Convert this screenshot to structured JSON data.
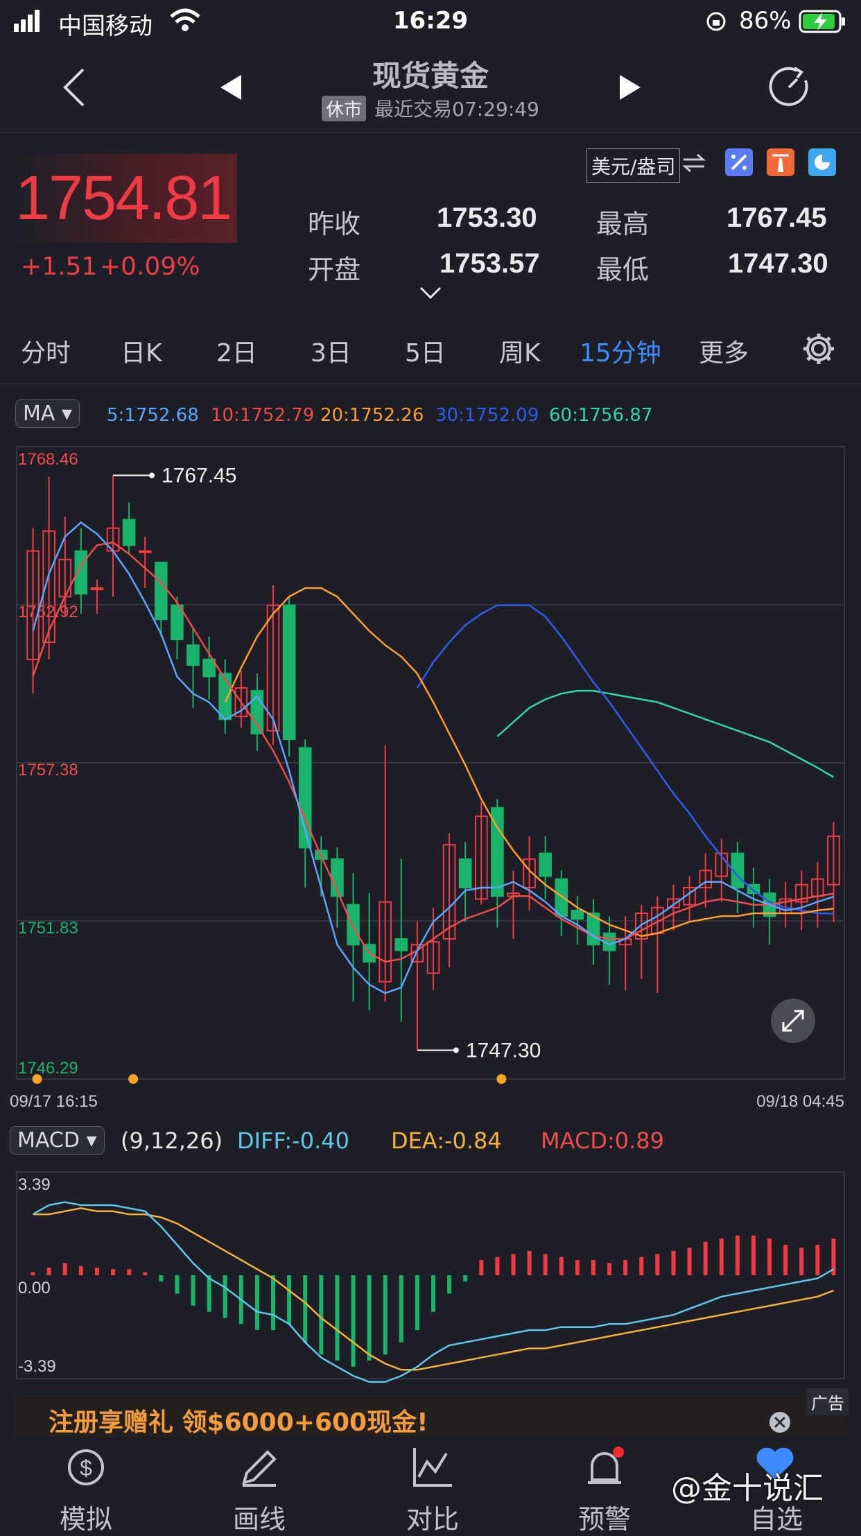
{
  "status": {
    "carrier": "中国移动",
    "time": "16:29",
    "battery": "86%"
  },
  "nav": {
    "title": "现货黄金",
    "market_status": "休市",
    "last_trade": "最近交易07:29:49"
  },
  "quote": {
    "price": "1754.81",
    "change": "+1.51",
    "change_pct": "+0.09%",
    "currency": "美元/盎司",
    "prev_close_label": "昨收",
    "prev_close": "1753.30",
    "high_label": "最高",
    "high": "1767.45",
    "open_label": "开盘",
    "open": "1753.57",
    "low_label": "最低",
    "low": "1747.30"
  },
  "tabs": [
    "分时",
    "日K",
    "2日",
    "3日",
    "5日",
    "周K",
    "15分钟",
    "更多"
  ],
  "active_tab": "15分钟",
  "ma": {
    "badge": "MA",
    "ma5": "5:1752.68",
    "ma10": "10:1752.79",
    "ma20": "20:1752.26",
    "ma30": "30:1752.09",
    "ma60": "60:1756.87"
  },
  "colors": {
    "up": "#ef3b45",
    "down": "#19b36b",
    "ma5": "#5aa6ff",
    "ma10": "#ef4b4b",
    "ma20": "#ff9d2e",
    "ma30": "#2f5cf0",
    "ma60": "#33d6a5",
    "accent": "#3d8bff"
  },
  "price_chart": {
    "y_labels": [
      "1768.46",
      "1762.92",
      "1757.38",
      "1751.83",
      "1746.29"
    ],
    "high_marker": "1767.45",
    "low_marker": "1747.30",
    "x_start": "09/17 16:15",
    "x_end": "09/18 04:45"
  },
  "macd": {
    "badge": "MACD",
    "params": "(9,12,26)",
    "diff": "DIFF:-0.40",
    "dea": "DEA:-0.84",
    "macd": "MACD:0.89",
    "y_labels": [
      "3.39",
      "0.00",
      "-3.39"
    ]
  },
  "ad": {
    "text": "注册享赠礼 领$6000+600现金!",
    "tag": "广告"
  },
  "bottom_nav": [
    "模拟",
    "画线",
    "对比",
    "预警",
    "自选"
  ],
  "watermark": "@金十说汇",
  "chart_data": {
    "type": "candlestick",
    "ylim": [
      1746.29,
      1768.46
    ],
    "candles": [
      [
        1761.0,
        1764.8,
        1759.8,
        1765.6
      ],
      [
        1761.6,
        1765.5,
        1761.0,
        1767.4
      ],
      [
        1763.2,
        1764.5,
        1762.5,
        1766.0
      ],
      [
        1764.8,
        1763.3,
        1762.6,
        1765.6
      ],
      [
        1763.5,
        1763.5,
        1762.6,
        1763.8
      ],
      [
        1764.8,
        1765.6,
        1763.2,
        1767.45
      ],
      [
        1765.9,
        1765.0,
        1764.7,
        1766.5
      ],
      [
        1764.8,
        1764.8,
        1763.5,
        1765.3
      ],
      [
        1764.4,
        1762.4,
        1761.8,
        1764.4
      ],
      [
        1762.9,
        1761.7,
        1761.0,
        1763.2
      ],
      [
        1761.5,
        1760.8,
        1759.3,
        1762.1
      ],
      [
        1761.0,
        1760.4,
        1759.6,
        1761.8
      ],
      [
        1760.5,
        1758.9,
        1758.4,
        1761.0
      ],
      [
        1759.0,
        1760.0,
        1758.6,
        1760.6
      ],
      [
        1759.9,
        1758.4,
        1757.8,
        1760.5
      ],
      [
        1758.5,
        1762.9,
        1758.0,
        1763.6
      ],
      [
        1762.9,
        1758.2,
        1757.6,
        1763.2
      ],
      [
        1757.9,
        1754.4,
        1753.0,
        1758.2
      ],
      [
        1754.3,
        1754.0,
        1752.7,
        1754.8
      ],
      [
        1754.0,
        1752.7,
        1751.6,
        1754.4
      ],
      [
        1752.4,
        1751.0,
        1749.0,
        1753.5
      ],
      [
        1751.0,
        1750.4,
        1748.7,
        1752.8
      ],
      [
        1749.7,
        1752.5,
        1749.0,
        1758.0
      ],
      [
        1751.2,
        1750.8,
        1748.3,
        1754.0
      ],
      [
        1750.4,
        1751.0,
        1747.3,
        1751.8
      ],
      [
        1750.0,
        1751.1,
        1749.4,
        1752.3
      ],
      [
        1751.2,
        1754.5,
        1750.2,
        1754.9
      ],
      [
        1754.0,
        1753.0,
        1751.8,
        1754.6
      ],
      [
        1752.6,
        1755.5,
        1752.4,
        1756.0
      ],
      [
        1755.8,
        1752.7,
        1751.6,
        1756.1
      ],
      [
        1752.7,
        1752.8,
        1751.2,
        1753.6
      ],
      [
        1753.0,
        1754.0,
        1752.2,
        1754.8
      ],
      [
        1754.2,
        1753.4,
        1752.6,
        1754.8
      ],
      [
        1753.3,
        1752.0,
        1751.3,
        1753.6
      ],
      [
        1752.2,
        1751.9,
        1751.0,
        1752.7
      ],
      [
        1752.1,
        1751.0,
        1750.3,
        1752.6
      ],
      [
        1751.4,
        1750.8,
        1749.6,
        1752.0
      ],
      [
        1751.0,
        1751.2,
        1749.4,
        1752.0
      ],
      [
        1751.2,
        1752.1,
        1749.8,
        1752.4
      ],
      [
        1751.4,
        1752.3,
        1749.3,
        1752.7
      ],
      [
        1752.3,
        1752.6,
        1751.5,
        1753.1
      ],
      [
        1752.4,
        1753.0,
        1751.8,
        1753.4
      ],
      [
        1753.0,
        1753.6,
        1752.3,
        1754.2
      ],
      [
        1753.4,
        1754.2,
        1752.5,
        1754.7
      ],
      [
        1754.2,
        1753.0,
        1752.1,
        1754.6
      ],
      [
        1753.1,
        1752.8,
        1751.6,
        1753.7
      ],
      [
        1752.8,
        1752.0,
        1751.0,
        1753.3
      ],
      [
        1752.1,
        1752.6,
        1751.6,
        1753.2
      ],
      [
        1752.5,
        1753.1,
        1751.5,
        1753.6
      ],
      [
        1752.7,
        1753.3,
        1751.6,
        1753.9
      ],
      [
        1753.1,
        1754.8,
        1751.8,
        1755.3
      ]
    ],
    "macd_hist": [
      0.1,
      0.25,
      0.4,
      0.3,
      0.25,
      0.2,
      0.2,
      0.1,
      -0.2,
      -0.6,
      -1.0,
      -1.2,
      -1.4,
      -1.6,
      -1.8,
      -1.8,
      -1.6,
      -2.2,
      -2.6,
      -2.8,
      -3.0,
      -2.8,
      -2.6,
      -2.2,
      -1.8,
      -1.2,
      -0.6,
      -0.2,
      0.5,
      0.6,
      0.7,
      0.8,
      0.7,
      0.6,
      0.5,
      0.5,
      0.4,
      0.5,
      0.6,
      0.7,
      0.8,
      0.9,
      1.1,
      1.2,
      1.3,
      1.3,
      1.2,
      1.0,
      0.9,
      1.0,
      1.2
    ],
    "diff": [
      2.0,
      2.3,
      2.4,
      2.3,
      2.3,
      2.3,
      2.2,
      2.1,
      1.6,
      1.0,
      0.4,
      -0.1,
      -0.4,
      -0.8,
      -1.2,
      -1.3,
      -1.6,
      -2.2,
      -2.7,
      -3.0,
      -3.3,
      -3.5,
      -3.5,
      -3.3,
      -3.0,
      -2.6,
      -2.3,
      -2.2,
      -2.1,
      -2.0,
      -1.9,
      -1.8,
      -1.8,
      -1.7,
      -1.7,
      -1.7,
      -1.6,
      -1.6,
      -1.5,
      -1.4,
      -1.3,
      -1.1,
      -0.9,
      -0.7,
      -0.6,
      -0.5,
      -0.4,
      -0.3,
      -0.2,
      -0.1,
      0.2
    ],
    "dea": [
      2.0,
      2.0,
      2.1,
      2.2,
      2.1,
      2.1,
      2.0,
      2.0,
      1.9,
      1.7,
      1.4,
      1.1,
      0.8,
      0.5,
      0.2,
      -0.1,
      -0.5,
      -0.9,
      -1.4,
      -1.8,
      -2.2,
      -2.6,
      -2.9,
      -3.1,
      -3.1,
      -3.0,
      -2.9,
      -2.8,
      -2.7,
      -2.6,
      -2.5,
      -2.4,
      -2.4,
      -2.3,
      -2.2,
      -2.1,
      -2.0,
      -1.9,
      -1.8,
      -1.7,
      -1.6,
      -1.5,
      -1.4,
      -1.3,
      -1.2,
      -1.1,
      -1.0,
      -0.9,
      -0.8,
      -0.7,
      -0.5
    ],
    "ma5": [
      1762.0,
      1764.0,
      1765.3,
      1765.8,
      1765.4,
      1764.8,
      1764.0,
      1763.0,
      1761.9,
      1760.4,
      1759.8,
      1759.5,
      1758.9,
      1759.2,
      1759.7,
      1758.9,
      1757.1,
      1755.0,
      1753.0,
      1751.0,
      1750.2,
      1749.6,
      1749.3,
      1749.5,
      1750.8,
      1751.8,
      1752.3,
      1752.9,
      1753.0,
      1753.0,
      1753.2,
      1752.9,
      1752.5,
      1752.0,
      1751.7,
      1751.3,
      1751.0,
      1751.2,
      1751.7,
      1752.0,
      1752.4,
      1752.8,
      1753.2,
      1753.2,
      1752.9,
      1752.6,
      1752.4,
      1752.2,
      1752.3,
      1752.5,
      1752.68
    ],
    "ma10": [
      1760.4,
      1762.0,
      1763.2,
      1764.3,
      1765.0,
      1765.1,
      1764.7,
      1764.2,
      1763.7,
      1763.0,
      1762.1,
      1761.2,
      1760.3,
      1759.5,
      1758.7,
      1757.8,
      1756.7,
      1755.4,
      1754.1,
      1752.9,
      1751.6,
      1750.7,
      1750.4,
      1750.5,
      1750.8,
      1751.2,
      1751.6,
      1751.9,
      1752.1,
      1752.3,
      1752.7,
      1752.7,
      1752.3,
      1751.9,
      1751.6,
      1751.3,
      1751.2,
      1751.2,
      1751.5,
      1751.8,
      1752.1,
      1752.3,
      1752.5,
      1752.6,
      1752.5,
      1752.4,
      1752.4,
      1752.5,
      1752.6,
      1752.7,
      1752.79
    ],
    "ma20": [
      1759.5,
      1760.7,
      1761.8,
      1762.6,
      1763.2,
      1763.5,
      1763.5,
      1763.2,
      1762.6,
      1762.0,
      1761.5,
      1761.1,
      1760.5,
      1759.5,
      1758.4,
      1757.3,
      1756.1,
      1755.1,
      1754.3,
      1753.6,
      1753.1,
      1752.7,
      1752.3,
      1752.0,
      1751.7,
      1751.5,
      1751.3,
      1751.4,
      1751.6,
      1751.8,
      1751.9,
      1752.0,
      1752.0,
      1752.1,
      1752.1,
      1752.1,
      1752.1,
      1752.2,
      1752.26
    ],
    "ma30": [
      1760.0,
      1760.9,
      1761.6,
      1762.2,
      1762.6,
      1762.9,
      1762.9,
      1762.9,
      1762.5,
      1761.8,
      1761.0,
      1760.2,
      1759.5,
      1758.7,
      1757.9,
      1757.1,
      1756.3,
      1755.6,
      1754.8,
      1754.1,
      1753.4,
      1752.9,
      1752.5,
      1752.3,
      1752.2,
      1752.1,
      1752.09
    ],
    "ma60": [
      1758.3,
      1758.8,
      1759.3,
      1759.6,
      1759.8,
      1759.9,
      1759.9,
      1759.8,
      1759.7,
      1759.6,
      1759.5,
      1759.3,
      1759.1,
      1758.9,
      1758.7,
      1758.5,
      1758.3,
      1758.1,
      1757.8,
      1757.5,
      1757.2,
      1756.87
    ]
  }
}
